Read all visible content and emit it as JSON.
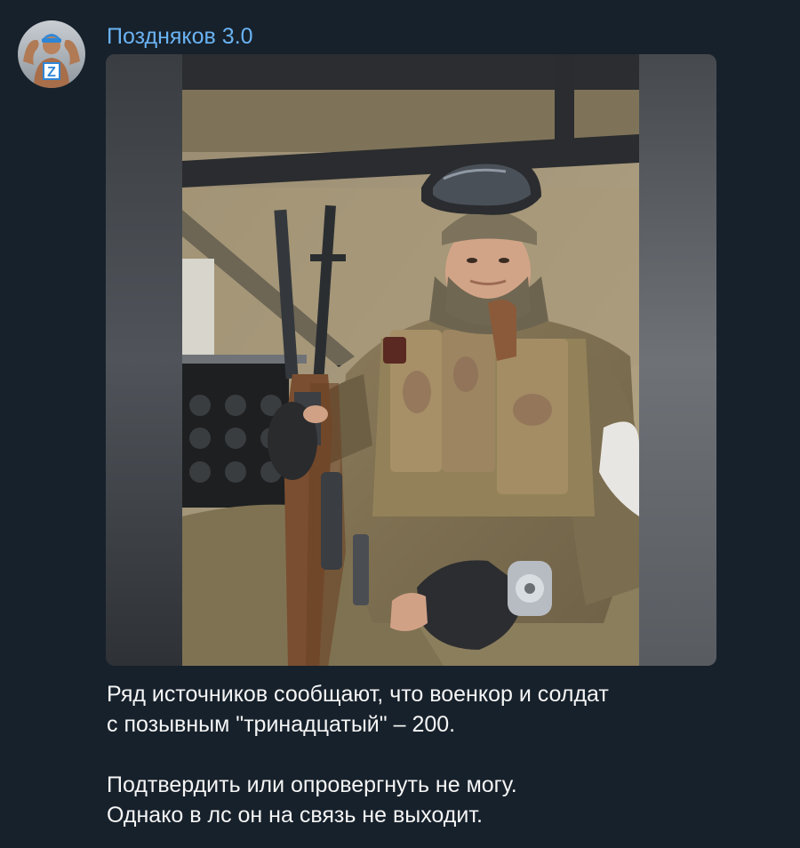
{
  "post": {
    "channel_name": "Поздняков 3.0",
    "avatar": {
      "icon": "channel-avatar-icon",
      "badge_letter": "Z"
    },
    "photo": {
      "icon": "soldier-photo"
    },
    "caption_lines": [
      "Ряд источников сообщают, что военкор и солдат",
      "с позывным \"тринадцатый\" – 200.",
      "",
      "Подтвердить или опровергнуть не могу.",
      "Однако в лс он на связь не выходит."
    ]
  },
  "colors": {
    "background": "#17212b",
    "channel_name": "#6ab3f3",
    "text": "#f5f5f5"
  }
}
